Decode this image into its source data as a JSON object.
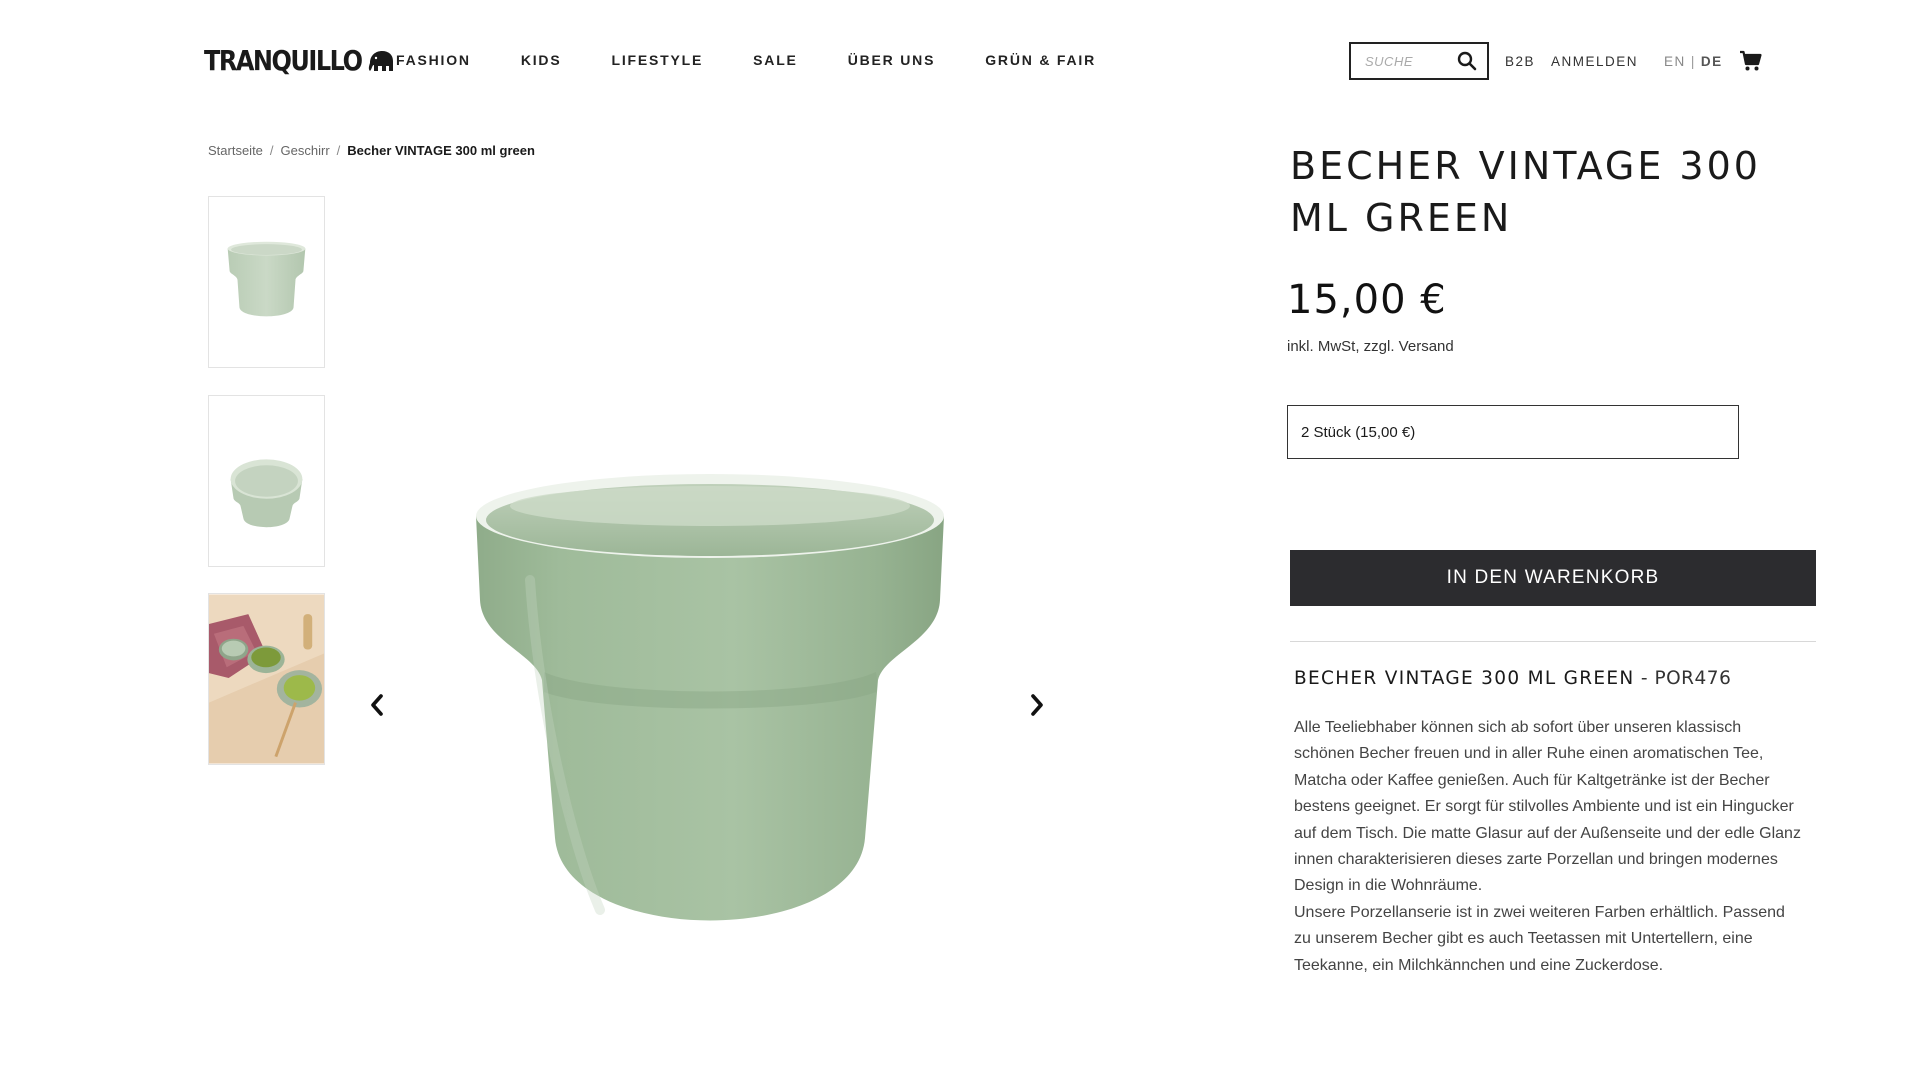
{
  "header": {
    "logo_text": "TRANQUILLO",
    "nav": [
      {
        "label": "FASHION"
      },
      {
        "label": "KIDS"
      },
      {
        "label": "LIFESTYLE"
      },
      {
        "label": "SALE"
      },
      {
        "label": "ÜBER UNS"
      },
      {
        "label": "GRÜN & FAIR"
      }
    ],
    "search_placeholder": "SUCHE",
    "b2b_label": "B2B",
    "login_label": "ANMELDEN",
    "lang_en": "EN",
    "lang_sep": "|",
    "lang_de": "DE"
  },
  "breadcrumb": {
    "items": [
      {
        "label": "Startseite"
      },
      {
        "label": "Geschirr"
      }
    ],
    "separator": "/",
    "current": "Becher VINTAGE 300 ml green"
  },
  "product": {
    "title": "BECHER VINTAGE 300 ML GREEN",
    "price": "15,00 €",
    "tax_note": "inkl. MwSt, zzgl. Versand",
    "variant_selected": "2 Stück (15,00 €)",
    "add_to_cart_label": "IN DEN WARENKORB",
    "desc_title": "BECHER VINTAGE 300 ML GREEN",
    "desc_sku": " - POR476",
    "desc_paragraph_1": "Alle Teeliebhaber können sich ab sofort über unseren klassisch schönen Becher freuen und in aller Ruhe einen aromatischen Tee, Matcha oder Kaffee genießen. Auch für Kaltgetränke ist der Becher bestens geeignet. Er sorgt für stilvolles Ambiente und ist ein Hingucker auf dem Tisch. Die matte Glasur auf der Außenseite und der edle Glanz innen charakterisieren dieses zarte Porzellan und bringen modernes Design in die Wohnräume.",
    "desc_paragraph_2": "Unsere Porzellanserie ist in zwei weiteren Farben erhältlich. Passend zu unserem Becher gibt es auch Teetassen mit Untertellern, eine Teekanne, ein Milchkännchen und eine Zuckerdose."
  },
  "colors": {
    "cup_green": "#9dba98",
    "cup_inner": "#d7e3d2",
    "button_dark": "#2c2c2f"
  },
  "icons": [
    "elephant-icon",
    "search-icon",
    "cart-icon",
    "chevron-left-icon",
    "chevron-right-icon"
  ]
}
